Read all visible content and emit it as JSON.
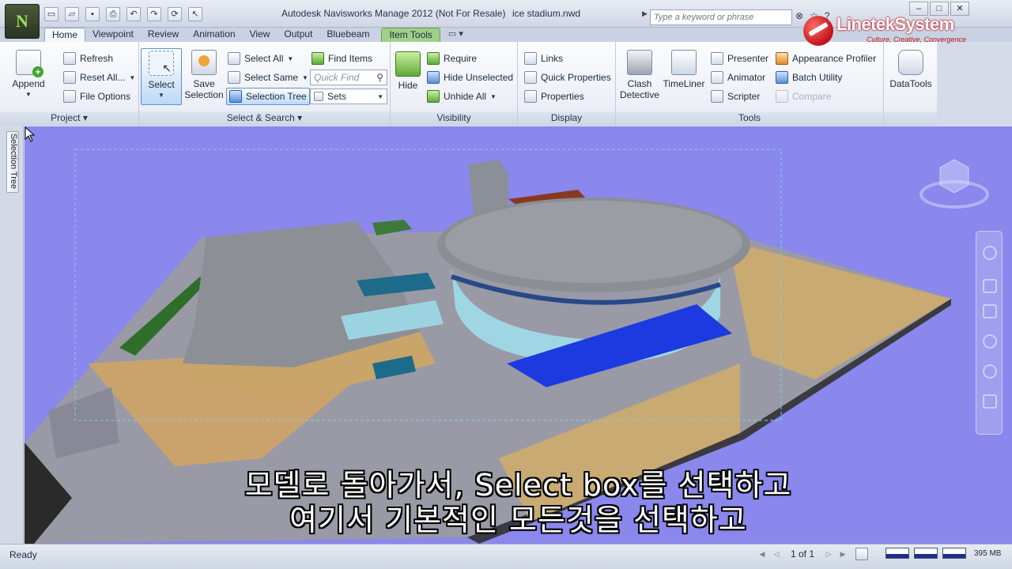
{
  "app": {
    "logo_letter": "N",
    "title": "Autodesk Navisworks Manage 2012 (Not For Resale)",
    "file": "ice stadium.nwd"
  },
  "quick_access": [
    "new-icon",
    "open-icon",
    "save-icon",
    "print-icon",
    "undo-icon",
    "redo-icon",
    "refresh-icon",
    "select-icon"
  ],
  "search": {
    "placeholder": "Type a keyword or phrase"
  },
  "window_controls": [
    "minimize-icon",
    "maximize-icon",
    "close-icon"
  ],
  "brand": {
    "name": "LinetekSystem",
    "tagline": "Culture, Creative, Convergence"
  },
  "tabs": [
    {
      "label": "Home",
      "active": true
    },
    {
      "label": "Viewpoint"
    },
    {
      "label": "Review"
    },
    {
      "label": "Animation"
    },
    {
      "label": "View"
    },
    {
      "label": "Output"
    },
    {
      "label": "Bluebeam"
    },
    {
      "label": "Item Tools",
      "contextual": true
    }
  ],
  "ribbon": {
    "project": {
      "title": "Project",
      "append": "Append",
      "refresh": "Refresh",
      "reset_all": "Reset All...",
      "file_options": "File Options"
    },
    "select_search": {
      "title": "Select & Search",
      "select": "Select",
      "save_selection": "Save Selection",
      "select_all": "Select All",
      "select_same": "Select Same",
      "selection_tree": "Selection Tree",
      "quick_find_placeholder": "Quick Find",
      "find_items": "Find Items",
      "sets": "Sets"
    },
    "visibility": {
      "title": "Visibility",
      "hide": "Hide",
      "require": "Require",
      "hide_unselected": "Hide Unselected",
      "unhide_all": "Unhide All"
    },
    "display": {
      "title": "Display",
      "links": "Links",
      "quick_properties": "Quick Properties",
      "properties": "Properties"
    },
    "tools": {
      "title": "Tools",
      "clash_detective_1": "Clash",
      "clash_detective_2": "Detective",
      "timeliner": "TimeLiner",
      "presenter": "Presenter",
      "animator": "Animator",
      "scripter": "Scripter",
      "appearance_profiler": "Appearance Profiler",
      "batch_utility": "Batch Utility",
      "compare": "Compare"
    },
    "datatools": "DataTools"
  },
  "left_dock": {
    "tab": "Selection Tree"
  },
  "viewport": {
    "subtitle_line1": "모델로 돌아가서, Select box를 선택하고",
    "subtitle_line2": "여기서 기본적인 모든것을 선택하고"
  },
  "status": {
    "text": "Ready",
    "page": "1 of 1",
    "memory": "395 MB"
  }
}
